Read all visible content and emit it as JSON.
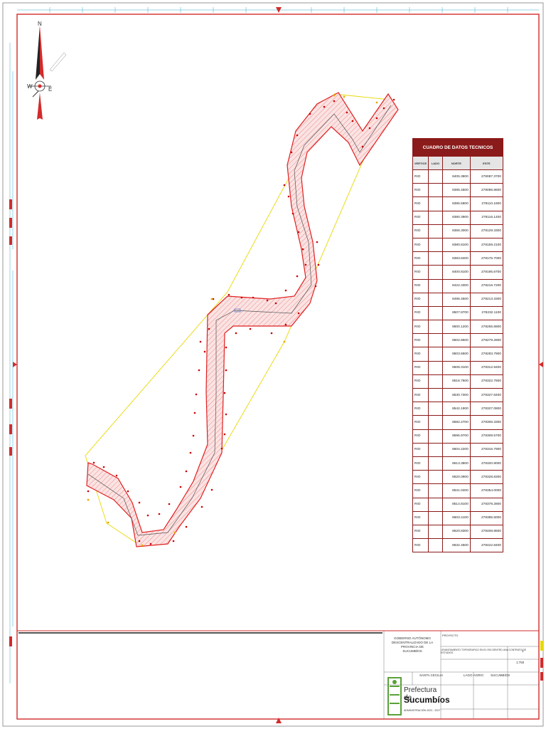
{
  "colors": {
    "frame": "#d22b2b",
    "accent_dark_red": "#8b1a1a",
    "corridor_fill": "#f5c6c6",
    "corridor_stroke": "#e02020",
    "parcel_outline": "#e8d800",
    "point_marker": "#cc0000",
    "zone_marker": "#e8a800",
    "ruler_blue": "#33aacc",
    "logo_green": "#5aa13a"
  },
  "compass": {
    "n": "N",
    "s": "S",
    "e": "E",
    "w": "W"
  },
  "table": {
    "title": "CUADRO DE DATOS TECNICOS",
    "headers": [
      "VERTICE",
      "LADO",
      "NORTE",
      "ESTE"
    ],
    "rows": [
      [
        "RIO",
        "",
        "8405.3800",
        "278087.3700"
      ],
      [
        "RIO",
        "",
        "8395.4500",
        "278096.8600"
      ],
      [
        "RIO",
        "",
        "8385.5800",
        "278110.1800"
      ],
      [
        "RIO",
        "",
        "8380.3900",
        "278116.1400"
      ],
      [
        "RIO",
        "",
        "8366.3000",
        "278129.3300"
      ],
      [
        "RIO",
        "",
        "8380.8100",
        "278159.2100"
      ],
      [
        "RIO",
        "",
        "8383.8400",
        "278176.7000"
      ],
      [
        "RIO",
        "",
        "8400.8100",
        "278195.6700"
      ],
      [
        "RIO",
        "",
        "8422.3300",
        "278216.7200"
      ],
      [
        "RIO",
        "",
        "8496.4500",
        "278213.3300"
      ],
      [
        "RIO",
        "",
        "8507.8700",
        "278232.1100"
      ],
      [
        "RIO",
        "",
        "8500.1200",
        "278255.6800"
      ],
      [
        "RIO",
        "",
        "8502.8500",
        "278279.2800"
      ],
      [
        "RIO",
        "",
        "8503.6500",
        "278283.7900"
      ],
      [
        "RIO",
        "",
        "8508.3100",
        "278312.9400"
      ],
      [
        "RIO",
        "",
        "8516.7600",
        "278322.7600"
      ],
      [
        "RIO",
        "",
        "8530.7300",
        "278327.8400"
      ],
      [
        "RIO",
        "",
        "8542.1900",
        "278327.0800"
      ],
      [
        "RIO",
        "",
        "8582.2700",
        "278306.3300"
      ],
      [
        "RIO",
        "",
        "8595.9700",
        "278309.5700"
      ],
      [
        "RIO",
        "",
        "8604.2200",
        "278316.7900"
      ],
      [
        "RIO",
        "",
        "8613.3800",
        "278320.8000"
      ],
      [
        "RIO",
        "",
        "8620.0900",
        "278328.8300"
      ],
      [
        "RIO",
        "",
        "8531.0400",
        "278354.0000"
      ],
      [
        "RIO",
        "",
        "8514.8100",
        "278378.2800"
      ],
      [
        "RIO",
        "",
        "8603.4100",
        "278385.5000"
      ],
      [
        "RIO",
        "",
        "8620.8300",
        "278408.8600"
      ],
      [
        "RIO",
        "",
        "8632.4500",
        "278422.8400"
      ]
    ]
  },
  "title_block": {
    "gov_lines": [
      "GOBIERNO AUTÓNOMO",
      "DESCENTRALIZADO DE LA PROVINCIA DE",
      "SUCUMBÍOS"
    ],
    "project_label": "PROYECTO",
    "project_text": "LEVANTAMIENTO TOPOGRAFICO EN EL RIO DENTRO UNA CONTRATO DE ESTUDIOS",
    "logo_line1": "Prefectura de",
    "logo_line2": "Sucumbíos",
    "logo_admin": "ADMINISTRACIÓN 2023 - 2027",
    "field_lamina": "1",
    "field_escala": "1:750",
    "sign1": "SANTA CECILIA",
    "sign2": "LAGO AGRIO",
    "sign3": "SUCUMBÍOS"
  }
}
